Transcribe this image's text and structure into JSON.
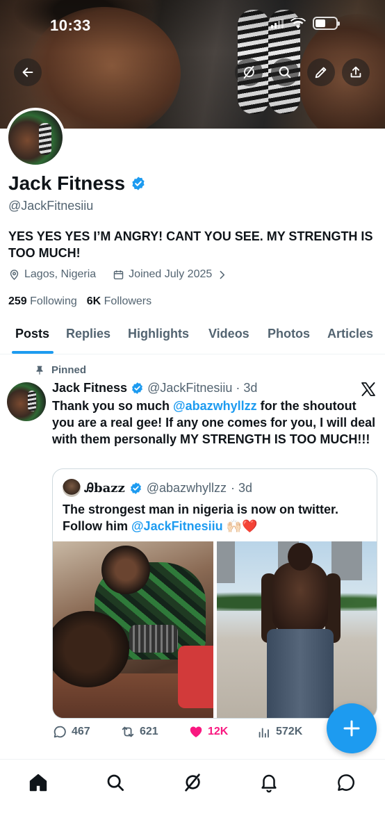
{
  "status_bar": {
    "time": "10:33"
  },
  "profile": {
    "display_name": "Jack Fitness",
    "handle": "@JackFitnesiiu",
    "bio": "YES YES YES I’M ANGRY! CANT YOU SEE. MY STRENGTH IS TOO MUCH!",
    "location": "Lagos, Nigeria",
    "joined": "Joined July 2025",
    "following_count": "259",
    "following_label": "Following",
    "followers_count": "6K",
    "followers_label": "Followers"
  },
  "tabs": [
    "Posts",
    "Replies",
    "Highlights",
    "Videos",
    "Photos",
    "Articles"
  ],
  "pinned_post": {
    "pinned_label": "Pinned",
    "author_name": "Jack Fitness",
    "author_handle": "@JackFitnesiiu",
    "time": "· 3d",
    "text_before": "Thank you so much ",
    "mention": "@abazwhyllzz",
    "text_after": " for the shoutout you are a real gee! If any one comes for you, I will deal with them personally MY STRENGTH IS TOO MUCH!!!",
    "quote": {
      "author_name": "Ꭿbazz",
      "author_handle": "@abazwhyllzz",
      "time": "· 3d",
      "text": "The strongest man in nigeria is now on twitter. Follow him ",
      "mention": "@JackFitnesiiu",
      "emoji": "🙌🏻❤️"
    },
    "stats": {
      "replies": "467",
      "reposts": "621",
      "likes": "12K",
      "views": "572K"
    }
  },
  "colors": {
    "accent": "#1d9bf0",
    "like": "#f91880",
    "secondary_text": "#536471"
  }
}
